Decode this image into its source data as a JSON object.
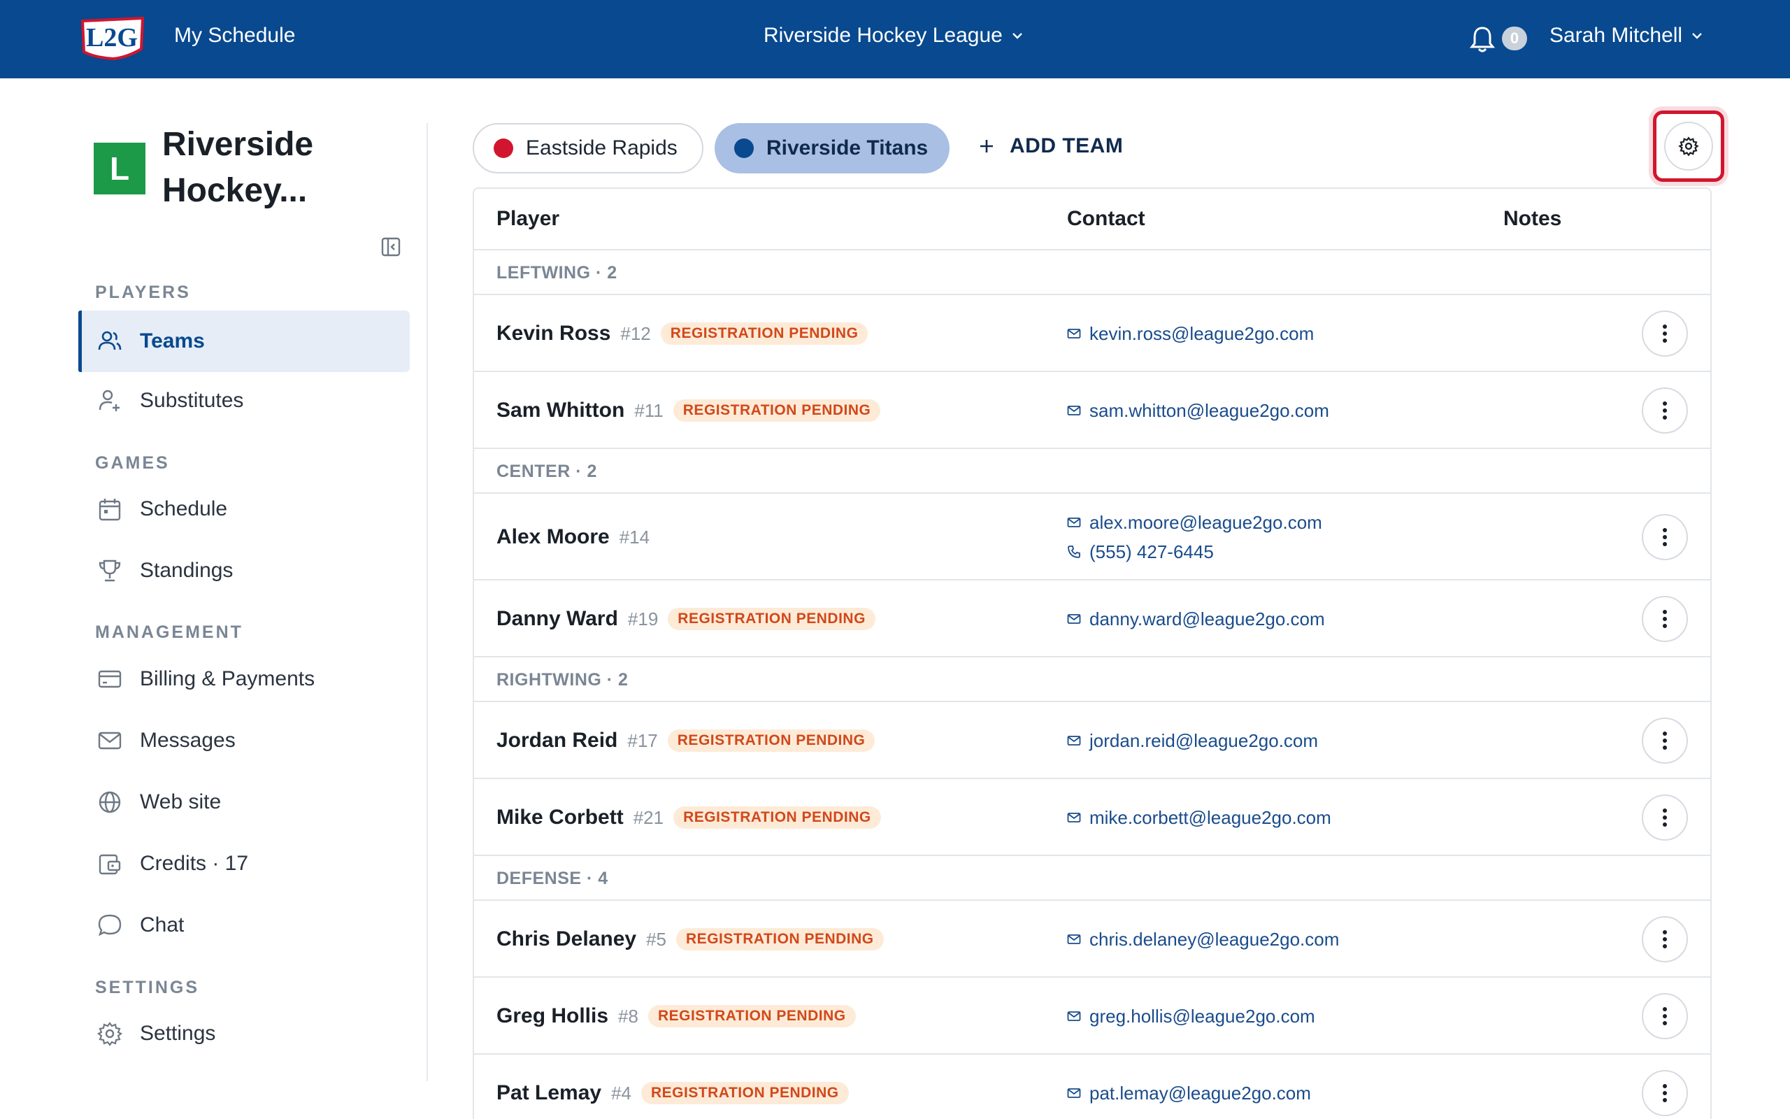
{
  "topbar": {
    "logo_text": "L2G",
    "my_schedule": "My Schedule",
    "league_name": "Riverside Hockey League",
    "notification_count": "0",
    "user_name": "Sarah Mitchell",
    "bg_color": "#08498f"
  },
  "sidebar": {
    "org_initial": "L",
    "org_name": "Riverside Hockey...",
    "sections": {
      "players": "PLAYERS",
      "games": "GAMES",
      "management": "MANAGEMENT",
      "settings": "SETTINGS"
    },
    "items": [
      {
        "label": "Teams",
        "icon": "users-icon",
        "active": true
      },
      {
        "label": "Substitutes",
        "icon": "user-plus-icon"
      },
      {
        "label": "Schedule",
        "icon": "calendar-icon"
      },
      {
        "label": "Standings",
        "icon": "trophy-icon"
      },
      {
        "label": "Billing & Payments",
        "icon": "credit-card-icon"
      },
      {
        "label": "Messages",
        "icon": "mail-icon"
      },
      {
        "label": "Web site",
        "icon": "globe-icon"
      },
      {
        "label": "Credits · 17",
        "icon": "wallet-icon"
      },
      {
        "label": "Chat",
        "icon": "chat-bubble-icon"
      },
      {
        "label": "Settings",
        "icon": "gear-icon"
      }
    ]
  },
  "teams": {
    "tabs": [
      {
        "name": "Eastside Rapids",
        "color": "#d2152e",
        "selected": false
      },
      {
        "name": "Riverside Titans",
        "color": "#08498f",
        "selected": true
      }
    ],
    "add_team": "ADD TEAM"
  },
  "table": {
    "headers": {
      "player": "Player",
      "contact": "Contact",
      "notes": "Notes"
    },
    "groups": [
      {
        "label": "LEFTWING · 2"
      },
      {
        "label": "CENTER · 2"
      },
      {
        "label": "RIGHTWING · 2"
      },
      {
        "label": "DEFENSE · 4"
      }
    ],
    "players": [
      {
        "name": "Kevin Ross",
        "number": "#12",
        "status": "REGISTRATION PENDING",
        "email": "kevin.ross@league2go.com"
      },
      {
        "name": "Sam Whitton",
        "number": "#11",
        "status": "REGISTRATION PENDING",
        "email": "sam.whitton@league2go.com"
      },
      {
        "name": "Alex Moore",
        "number": "#14",
        "email": "alex.moore@league2go.com",
        "phone": "(555) 427-6445"
      },
      {
        "name": "Danny Ward",
        "number": "#19",
        "status": "REGISTRATION PENDING",
        "email": "danny.ward@league2go.com"
      },
      {
        "name": "Jordan Reid",
        "number": "#17",
        "status": "REGISTRATION PENDING",
        "email": "jordan.reid@league2go.com"
      },
      {
        "name": "Mike Corbett",
        "number": "#21",
        "status": "REGISTRATION PENDING",
        "email": "mike.corbett@league2go.com"
      },
      {
        "name": "Chris Delaney",
        "number": "#5",
        "status": "REGISTRATION PENDING",
        "email": "chris.delaney@league2go.com"
      },
      {
        "name": "Greg Hollis",
        "number": "#8",
        "status": "REGISTRATION PENDING",
        "email": "greg.hollis@league2go.com"
      },
      {
        "name": "Pat Lemay",
        "number": "#4",
        "status": "REGISTRATION PENDING",
        "email": "pat.lemay@league2go.com"
      }
    ]
  }
}
